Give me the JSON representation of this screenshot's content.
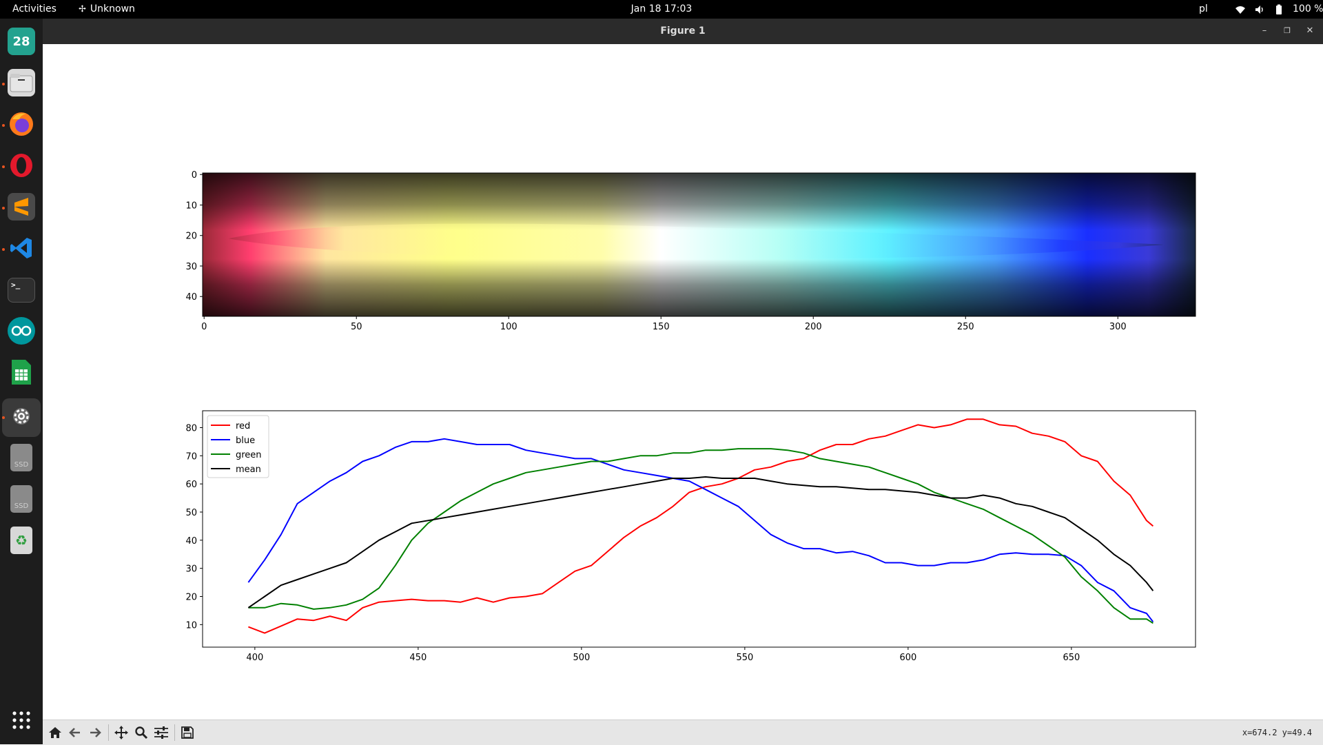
{
  "topbar": {
    "activities": "Activities",
    "app_name": "Unknown",
    "clock": "Jan 18  17:03",
    "keyboard_layout": "pl",
    "battery": "100 %"
  },
  "dock": {
    "calendar_day": "28",
    "drive1_label": "SSD",
    "drive2_label": "SSD"
  },
  "window": {
    "title": "Figure 1"
  },
  "toolbar": {
    "coords": "x=674.2 y=49.4"
  },
  "chart_data": [
    {
      "type": "heatmap",
      "description_ref": "image",
      "x_ticks": [
        0,
        50,
        100,
        150,
        200,
        250,
        300
      ],
      "y_ticks": [
        0,
        10,
        20,
        30,
        40
      ],
      "xlim": [
        -0.5,
        325.5
      ],
      "ylim": [
        46.5,
        -0.5
      ],
      "gradient_stops": [
        {
          "x": 0,
          "color": "#9e2a3a"
        },
        {
          "x": 15,
          "color": "#ff3e6e"
        },
        {
          "x": 40,
          "color": "#ffe6a0"
        },
        {
          "x": 80,
          "color": "#ffff8a"
        },
        {
          "x": 130,
          "color": "#fffdaa"
        },
        {
          "x": 150,
          "color": "#ffffff"
        },
        {
          "x": 190,
          "color": "#b7fff5"
        },
        {
          "x": 225,
          "color": "#5ff2ff"
        },
        {
          "x": 260,
          "color": "#4a9fff"
        },
        {
          "x": 290,
          "color": "#1a2fff"
        },
        {
          "x": 310,
          "color": "#3a3ad8"
        },
        {
          "x": 325,
          "color": "#1a2a4a"
        }
      ]
    },
    {
      "type": "line",
      "x": [
        398,
        403,
        408,
        413,
        418,
        423,
        428,
        433,
        438,
        443,
        448,
        453,
        458,
        463,
        468,
        473,
        478,
        483,
        488,
        493,
        498,
        503,
        508,
        513,
        518,
        523,
        528,
        533,
        538,
        543,
        548,
        553,
        558,
        563,
        568,
        573,
        578,
        583,
        588,
        593,
        598,
        603,
        608,
        613,
        618,
        623,
        628,
        633,
        638,
        643,
        648,
        653,
        658,
        663,
        668,
        673,
        675
      ],
      "series": [
        {
          "name": "red",
          "color": "#ff0000",
          "values": [
            9.2,
            7,
            9.5,
            12,
            11.5,
            13,
            11.5,
            16,
            18,
            18.5,
            19,
            18.5,
            18.5,
            18,
            19.5,
            18,
            19.5,
            20,
            21,
            25,
            29,
            31,
            36,
            41,
            45,
            48,
            52,
            57,
            59,
            60,
            62,
            65,
            66,
            68,
            69,
            72,
            74,
            74,
            76,
            77,
            79,
            81,
            80,
            81,
            83,
            83,
            81,
            80.5,
            78,
            77,
            75,
            70,
            68,
            61,
            56,
            47,
            45
          ]
        },
        {
          "name": "blue",
          "color": "#0000ff",
          "values": [
            25,
            33,
            42,
            53,
            57,
            61,
            64,
            68,
            70,
            73,
            75,
            75,
            76,
            75,
            74,
            74,
            74,
            72,
            71,
            70,
            69,
            69,
            67,
            65,
            64,
            63,
            62,
            61,
            58,
            55,
            52,
            47,
            42,
            39,
            37,
            37,
            35.5,
            36,
            34.5,
            32,
            32,
            31,
            31,
            32,
            32,
            33,
            35,
            35.5,
            35,
            35,
            34.5,
            31,
            25,
            22,
            16,
            14,
            11
          ]
        },
        {
          "name": "green",
          "color": "#008000",
          "values": [
            16,
            16,
            17.5,
            17,
            15.5,
            16,
            17,
            19,
            23,
            31,
            40,
            46,
            50,
            54,
            57,
            60,
            62,
            64,
            65,
            66,
            67,
            68,
            68,
            69,
            70,
            70,
            71,
            71,
            72,
            72,
            72.5,
            72.5,
            72.5,
            72,
            71,
            69,
            68,
            67,
            66,
            64,
            62,
            60,
            57,
            55,
            53,
            51,
            48,
            45,
            42,
            38,
            34,
            27,
            22,
            16,
            12,
            12,
            10.5
          ]
        },
        {
          "name": "mean",
          "color": "#000000",
          "values": [
            16,
            20,
            24,
            26,
            28,
            30,
            32,
            36,
            40,
            43,
            46,
            47,
            48,
            49,
            50,
            51,
            52,
            53,
            54,
            55,
            56,
            57,
            58,
            59,
            60,
            61,
            62,
            62,
            62.5,
            62,
            62,
            62,
            61,
            60,
            59.5,
            59,
            59,
            58.5,
            58,
            58,
            57.5,
            57,
            56,
            55,
            55,
            56,
            55,
            53,
            52,
            50,
            48,
            44,
            40,
            35,
            31,
            25,
            22
          ]
        }
      ],
      "xlim": [
        384,
        688
      ],
      "ylim": [
        2,
        86
      ],
      "x_ticks": [
        400,
        450,
        500,
        550,
        600,
        650
      ],
      "y_ticks": [
        10,
        20,
        30,
        40,
        50,
        60,
        70,
        80
      ],
      "legend": "upper-left",
      "grid": false
    }
  ]
}
